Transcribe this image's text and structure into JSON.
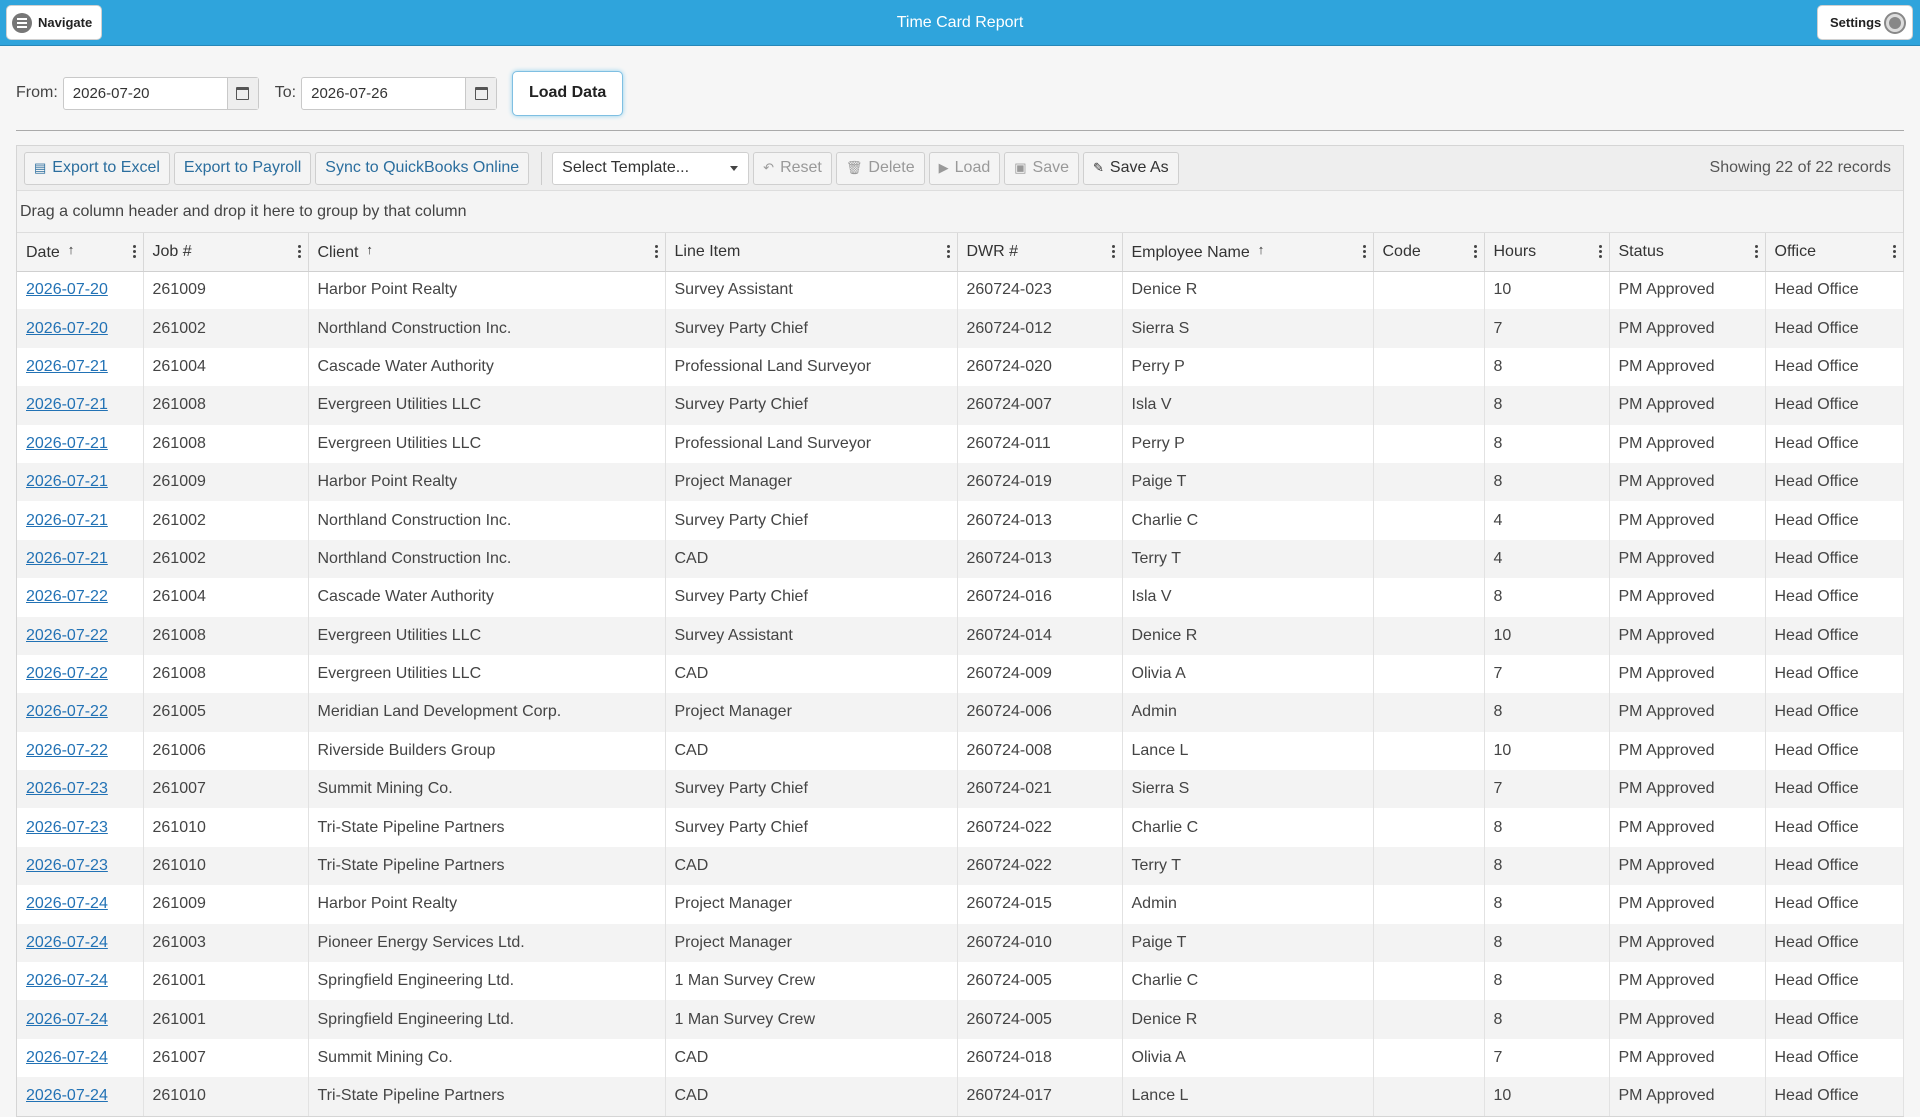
{
  "header": {
    "title": "Time Card Report",
    "navigate_label": "Navigate",
    "settings_label": "Settings"
  },
  "filter": {
    "from_label": "From:",
    "from_value": "2026-07-20",
    "to_label": "To:",
    "to_value": "2026-07-26",
    "load_label": "Load Data"
  },
  "toolbar": {
    "export_excel": "Export to Excel",
    "export_payroll": "Export to Payroll",
    "sync_qbo": "Sync to QuickBooks Online",
    "template_placeholder": "Select Template...",
    "reset": "Reset",
    "delete": "Delete",
    "load": "Load",
    "save": "Save",
    "save_as": "Save As",
    "records": "Showing 22 of 22 records"
  },
  "group_panel": "Drag a column header and drop it here to group by that column",
  "columns": [
    "Date",
    "Job #",
    "Client",
    "Line Item",
    "DWR #",
    "Employee Name",
    "Code",
    "Hours",
    "Status",
    "Office"
  ],
  "rows": [
    [
      "2026-07-20",
      "261009",
      "Harbor Point Realty",
      "Survey Assistant",
      "260724-023",
      "Denice R",
      "",
      "10",
      "PM Approved",
      "Head Office"
    ],
    [
      "2026-07-20",
      "261002",
      "Northland Construction Inc.",
      "Survey Party Chief",
      "260724-012",
      "Sierra S",
      "",
      "7",
      "PM Approved",
      "Head Office"
    ],
    [
      "2026-07-21",
      "261004",
      "Cascade Water Authority",
      "Professional Land Surveyor",
      "260724-020",
      "Perry P",
      "",
      "8",
      "PM Approved",
      "Head Office"
    ],
    [
      "2026-07-21",
      "261008",
      "Evergreen Utilities LLC",
      "Survey Party Chief",
      "260724-007",
      "Isla V",
      "",
      "8",
      "PM Approved",
      "Head Office"
    ],
    [
      "2026-07-21",
      "261008",
      "Evergreen Utilities LLC",
      "Professional Land Surveyor",
      "260724-011",
      "Perry P",
      "",
      "8",
      "PM Approved",
      "Head Office"
    ],
    [
      "2026-07-21",
      "261009",
      "Harbor Point Realty",
      "Project Manager",
      "260724-019",
      "Paige T",
      "",
      "8",
      "PM Approved",
      "Head Office"
    ],
    [
      "2026-07-21",
      "261002",
      "Northland Construction Inc.",
      "Survey Party Chief",
      "260724-013",
      "Charlie C",
      "",
      "4",
      "PM Approved",
      "Head Office"
    ],
    [
      "2026-07-21",
      "261002",
      "Northland Construction Inc.",
      "CAD",
      "260724-013",
      "Terry T",
      "",
      "4",
      "PM Approved",
      "Head Office"
    ],
    [
      "2026-07-22",
      "261004",
      "Cascade Water Authority",
      "Survey Party Chief",
      "260724-016",
      "Isla V",
      "",
      "8",
      "PM Approved",
      "Head Office"
    ],
    [
      "2026-07-22",
      "261008",
      "Evergreen Utilities LLC",
      "Survey Assistant",
      "260724-014",
      "Denice R",
      "",
      "10",
      "PM Approved",
      "Head Office"
    ],
    [
      "2026-07-22",
      "261008",
      "Evergreen Utilities LLC",
      "CAD",
      "260724-009",
      "Olivia A",
      "",
      "7",
      "PM Approved",
      "Head Office"
    ],
    [
      "2026-07-22",
      "261005",
      "Meridian Land Development Corp.",
      "Project Manager",
      "260724-006",
      "Admin",
      "",
      "8",
      "PM Approved",
      "Head Office"
    ],
    [
      "2026-07-22",
      "261006",
      "Riverside Builders Group",
      "CAD",
      "260724-008",
      "Lance L",
      "",
      "10",
      "PM Approved",
      "Head Office"
    ],
    [
      "2026-07-23",
      "261007",
      "Summit Mining Co.",
      "Survey Party Chief",
      "260724-021",
      "Sierra S",
      "",
      "7",
      "PM Approved",
      "Head Office"
    ],
    [
      "2026-07-23",
      "261010",
      "Tri-State Pipeline Partners",
      "Survey Party Chief",
      "260724-022",
      "Charlie C",
      "",
      "8",
      "PM Approved",
      "Head Office"
    ],
    [
      "2026-07-23",
      "261010",
      "Tri-State Pipeline Partners",
      "CAD",
      "260724-022",
      "Terry T",
      "",
      "8",
      "PM Approved",
      "Head Office"
    ],
    [
      "2026-07-24",
      "261009",
      "Harbor Point Realty",
      "Project Manager",
      "260724-015",
      "Admin",
      "",
      "8",
      "PM Approved",
      "Head Office"
    ],
    [
      "2026-07-24",
      "261003",
      "Pioneer Energy Services Ltd.",
      "Project Manager",
      "260724-010",
      "Paige T",
      "",
      "8",
      "PM Approved",
      "Head Office"
    ],
    [
      "2026-07-24",
      "261001",
      "Springfield Engineering Ltd.",
      "1 Man Survey Crew",
      "260724-005",
      "Charlie C",
      "",
      "8",
      "PM Approved",
      "Head Office"
    ],
    [
      "2026-07-24",
      "261001",
      "Springfield Engineering Ltd.",
      "1 Man Survey Crew",
      "260724-005",
      "Denice R",
      "",
      "8",
      "PM Approved",
      "Head Office"
    ],
    [
      "2026-07-24",
      "261007",
      "Summit Mining Co.",
      "CAD",
      "260724-018",
      "Olivia A",
      "",
      "7",
      "PM Approved",
      "Head Office"
    ],
    [
      "2026-07-24",
      "261010",
      "Tri-State Pipeline Partners",
      "CAD",
      "260724-017",
      "Lance L",
      "",
      "10",
      "PM Approved",
      "Head Office"
    ]
  ]
}
